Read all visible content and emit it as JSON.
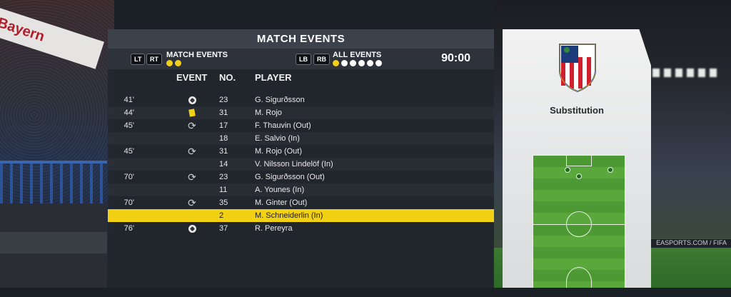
{
  "background": {
    "banner_text": "Bayern",
    "ad_board_text": "EASPORTS.COM / FIFA"
  },
  "panel": {
    "title": "MATCH EVENTS",
    "filters": {
      "left_buttons": [
        "LT",
        "RT"
      ],
      "left_label": "MATCH EVENTS",
      "left_dots": [
        true,
        true
      ],
      "right_buttons": [
        "LB",
        "RB"
      ],
      "right_label": "ALL EVENTS",
      "right_dots": [
        true,
        false,
        false,
        false,
        false,
        false
      ]
    },
    "clock": "90:00",
    "columns": {
      "event": "EVENT",
      "no": "NO.",
      "player": "PLAYER"
    },
    "rows": [
      {
        "minute": "41'",
        "icon": "ball-icon",
        "no": "23",
        "player": "G. Sigurðsson"
      },
      {
        "minute": "44'",
        "icon": "yellow-card-icon",
        "no": "31",
        "player": "M. Rojo"
      },
      {
        "minute": "45'",
        "icon": "substitution-icon",
        "no": "17",
        "player": "F. Thauvin (Out)"
      },
      {
        "minute": "",
        "icon": "",
        "no": "18",
        "player": "E. Salvio (In)"
      },
      {
        "minute": "45'",
        "icon": "substitution-icon",
        "no": "31",
        "player": "M. Rojo (Out)"
      },
      {
        "minute": "",
        "icon": "",
        "no": "14",
        "player": "V. Nilsson Lindelöf (In)"
      },
      {
        "minute": "70'",
        "icon": "substitution-icon",
        "no": "23",
        "player": "G. Sigurðsson (Out)"
      },
      {
        "minute": "",
        "icon": "",
        "no": "11",
        "player": "A. Younes (In)"
      },
      {
        "minute": "70'",
        "icon": "substitution-icon",
        "no": "35",
        "player": "M. Ginter (Out)"
      },
      {
        "minute": "",
        "icon": "",
        "no": "2",
        "player": "M. Schneiderlin (In)"
      },
      {
        "minute": "76'",
        "icon": "ball-icon",
        "no": "37",
        "player": "R. Pereyra"
      }
    ],
    "selected_row": 9
  },
  "side_card": {
    "title": "Substitution",
    "crest_icon": "club-crest-icon"
  },
  "colors": {
    "highlight": "#f2d115",
    "panel_bg": "#22262e",
    "accent_dot": "#f2cf1b"
  }
}
